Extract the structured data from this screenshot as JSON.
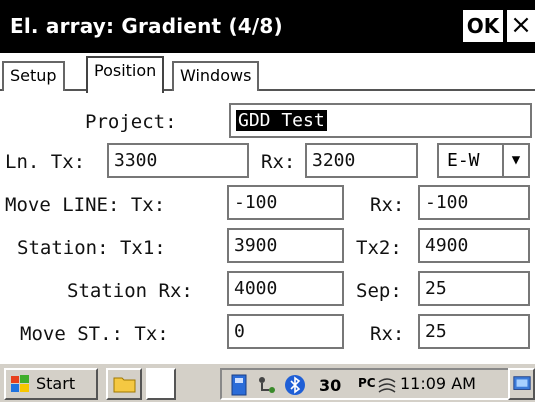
{
  "window": {
    "title": "El. array: Gradient (4/8)",
    "ok_label": "OK",
    "close_label": "×"
  },
  "tabs": [
    {
      "label": "Setup",
      "active": false
    },
    {
      "label": "Position",
      "active": true
    },
    {
      "label": "Windows",
      "active": false
    }
  ],
  "form": {
    "project_label": "Project:",
    "project_value": "GDD Test",
    "ln_tx_label": "Ln. Tx:",
    "ln_tx_value": "3300",
    "rx_label": "Rx:",
    "rx_value": "3200",
    "direction_value": "E-W",
    "move_line_tx_label": "Move LINE: Tx:",
    "move_line_tx_value": "-100",
    "move_line_rx_label": "Rx:",
    "move_line_rx_value": "-100",
    "station_tx1_label": "Station: Tx1:",
    "station_tx1_value": "3900",
    "tx2_label": "Tx2:",
    "tx2_value": "4900",
    "station_rx_label": "Station Rx:",
    "station_rx_value": "4000",
    "sep_label": "Sep:",
    "sep_value": "25",
    "move_st_tx_label": "Move ST.: Tx:",
    "move_st_tx_value": "0",
    "move_st_rx_label": "Rx:",
    "move_st_rx_value": "25"
  },
  "taskbar": {
    "start_label": "Start",
    "clock": "11:09 AM",
    "tray_text": "PC",
    "icons": [
      "windows-flag-icon",
      "folder-icon",
      "keyboard-icon",
      "network-icon",
      "bluetooth-icon",
      "volume-icon",
      "desktop-icon"
    ]
  }
}
